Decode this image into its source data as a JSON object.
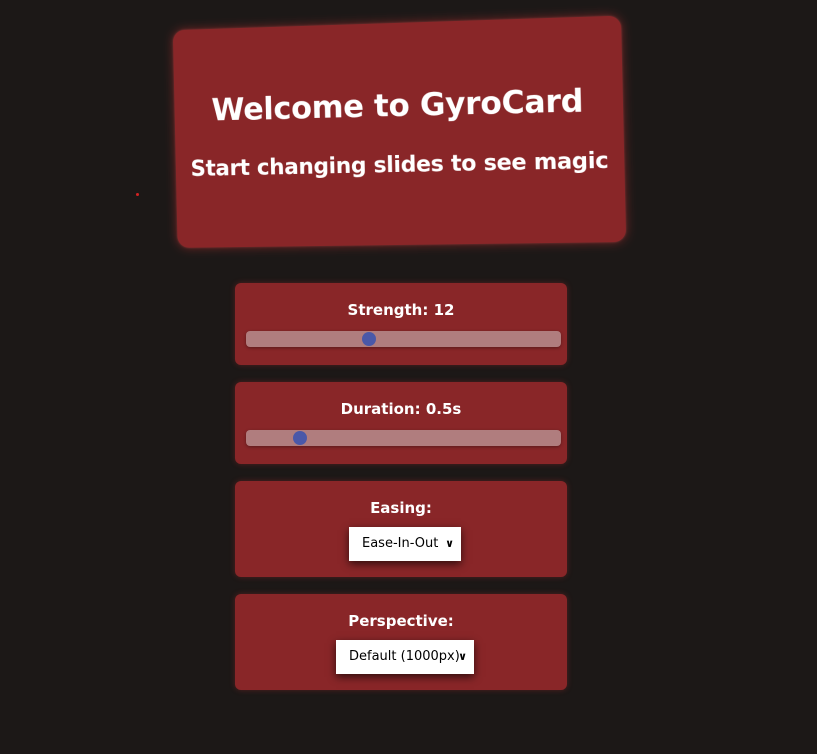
{
  "hero": {
    "title": "Welcome to GyroCard",
    "subtitle": "Start changing slides to see magic"
  },
  "controls": {
    "strength": {
      "label": "Strength: 12",
      "value_fraction": 0.39
    },
    "duration": {
      "label": "Duration: 0.5s",
      "value_fraction": 0.17
    },
    "easing": {
      "label": "Easing:",
      "selected": "Ease-In-Out"
    },
    "perspective": {
      "label": "Perspective:",
      "selected": "Default (1000px)"
    }
  },
  "colors": {
    "background": "#1c1817",
    "card": "#892628",
    "slider_track": "#b07d7e",
    "slider_thumb": "#4a58a8"
  },
  "icons": {
    "select_arrow": "chevron-down-icon"
  }
}
